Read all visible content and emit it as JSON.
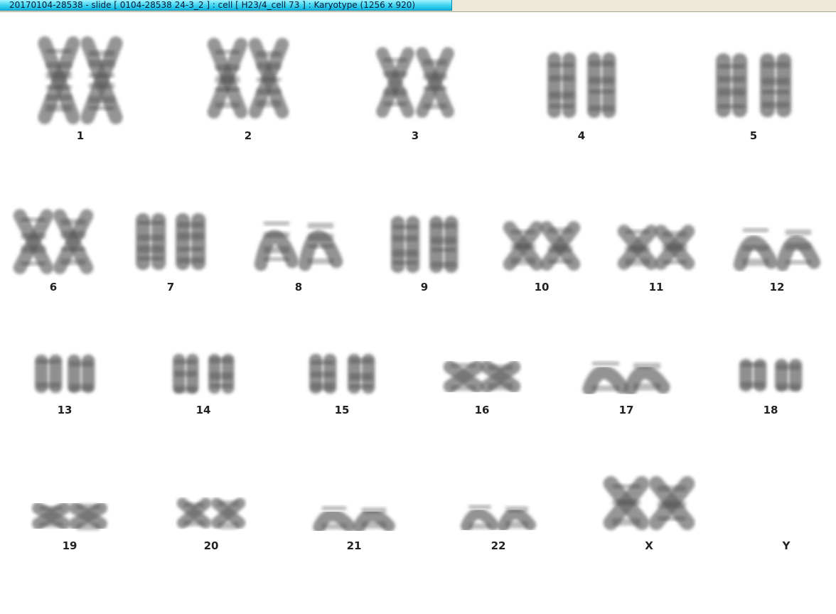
{
  "window": {
    "title": "20170104-28538 - slide [ 0104-28538 24-3_2 ] : cell [ H23/4_cell 73 ] : Karyotype  (1256 x 920)"
  },
  "karyotype": {
    "pairs": [
      {
        "label": "1",
        "count": 2
      },
      {
        "label": "2",
        "count": 2
      },
      {
        "label": "3",
        "count": 2
      },
      {
        "label": "4",
        "count": 2
      },
      {
        "label": "5",
        "count": 2
      },
      {
        "label": "6",
        "count": 2
      },
      {
        "label": "7",
        "count": 2
      },
      {
        "label": "8",
        "count": 2
      },
      {
        "label": "9",
        "count": 2
      },
      {
        "label": "10",
        "count": 2
      },
      {
        "label": "11",
        "count": 2
      },
      {
        "label": "12",
        "count": 2
      },
      {
        "label": "13",
        "count": 2
      },
      {
        "label": "14",
        "count": 2
      },
      {
        "label": "15",
        "count": 2
      },
      {
        "label": "16",
        "count": 2
      },
      {
        "label": "17",
        "count": 2
      },
      {
        "label": "18",
        "count": 2
      },
      {
        "label": "19",
        "count": 2
      },
      {
        "label": "20",
        "count": 2
      },
      {
        "label": "21",
        "count": 2
      },
      {
        "label": "22",
        "count": 2
      },
      {
        "label": "X",
        "count": 2
      },
      {
        "label": "Y",
        "count": 0
      }
    ]
  },
  "colors": {
    "title_tab": "#3ed3f0",
    "chromosome": "#6a6a6a",
    "band": "#3a3a3a",
    "label": "#222222"
  }
}
